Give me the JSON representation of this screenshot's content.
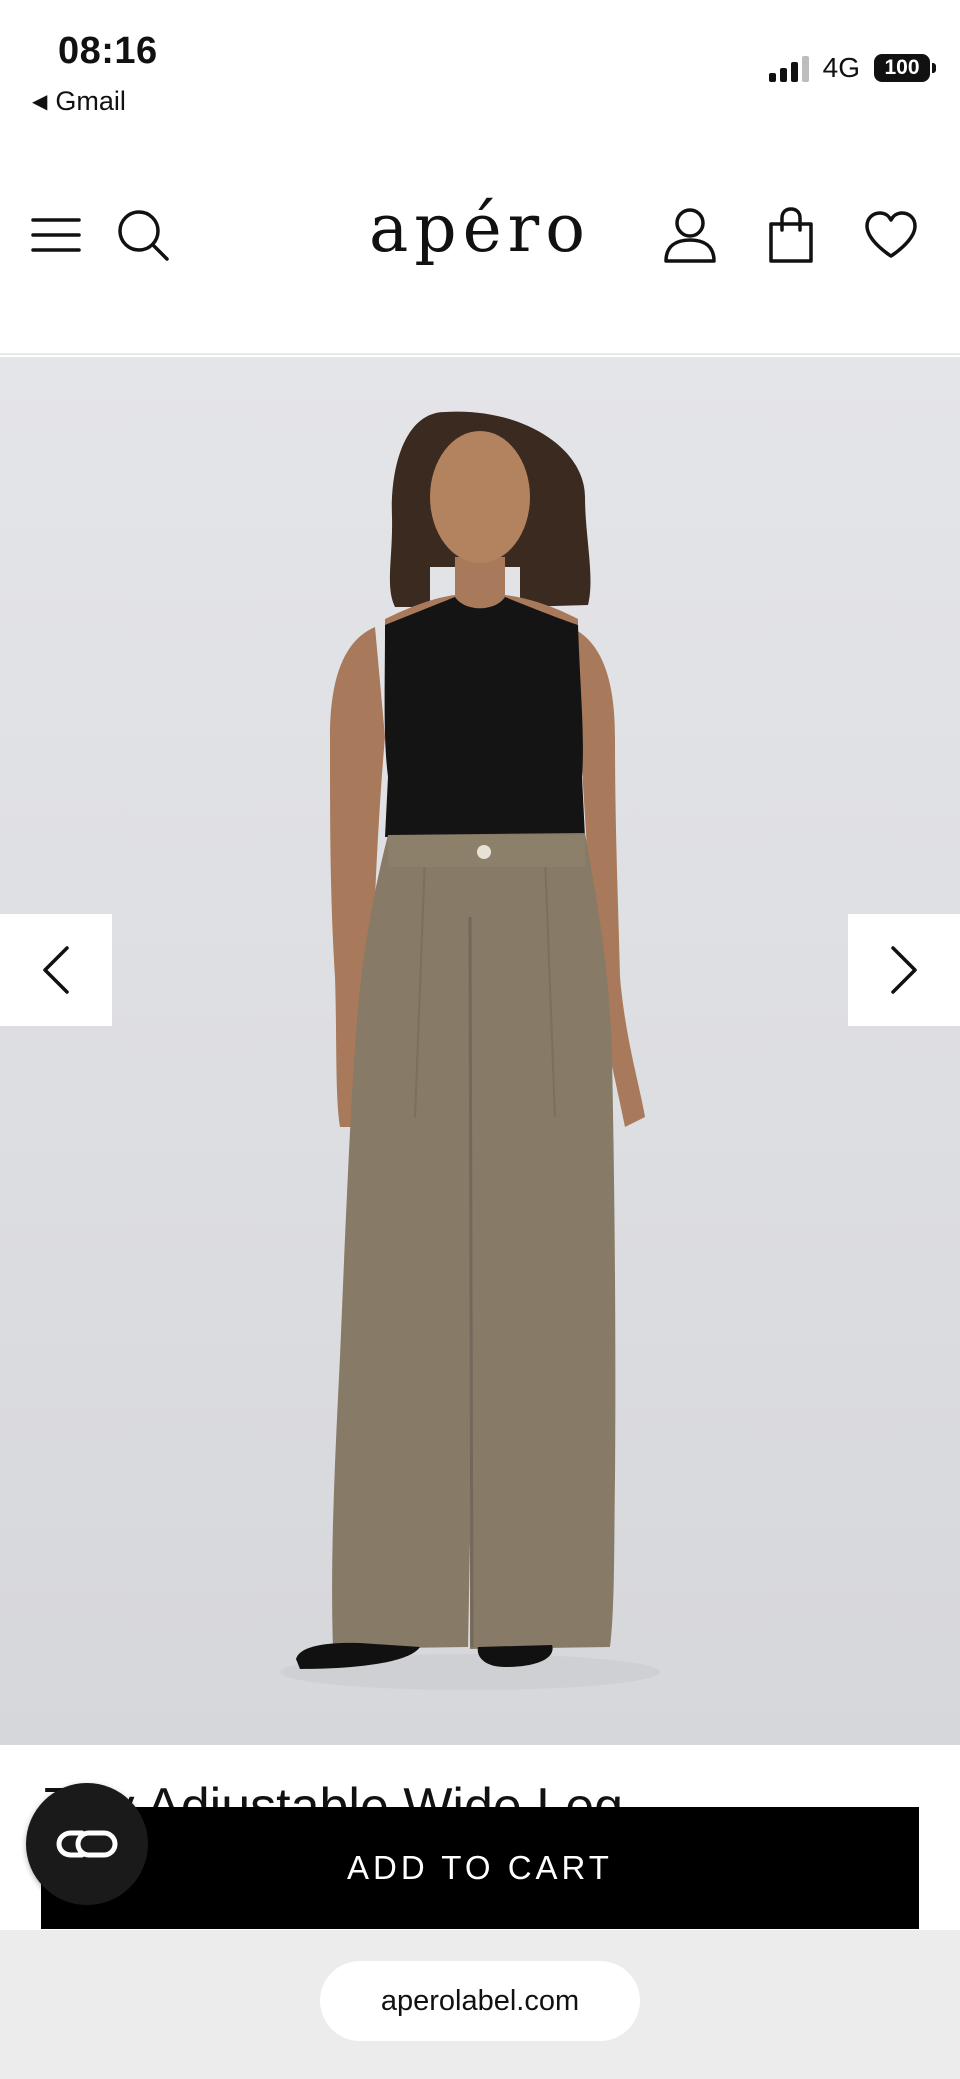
{
  "status_bar": {
    "time": "08:16",
    "back_app": "Gmail",
    "network": "4G",
    "battery": "100"
  },
  "header": {
    "logo": "apéro",
    "icons": [
      "menu-icon",
      "search-icon",
      "account-icon",
      "shopping-bag-icon",
      "wishlist-heart-icon"
    ]
  },
  "product": {
    "title": "Tilly Adjustable Wide Leg",
    "add_to_cart_label": "ADD TO CART",
    "image_nav": [
      "chevron-left-icon",
      "chevron-right-icon"
    ]
  },
  "chat": {
    "icon": "chat-widget-icon"
  },
  "browser": {
    "url": "aperolabel.com"
  },
  "colors": {
    "cta_background": "#000000",
    "cta_text": "#ffffff",
    "hero_background": "#dfe0e4",
    "pants": "#877a66",
    "top": "#141414"
  }
}
